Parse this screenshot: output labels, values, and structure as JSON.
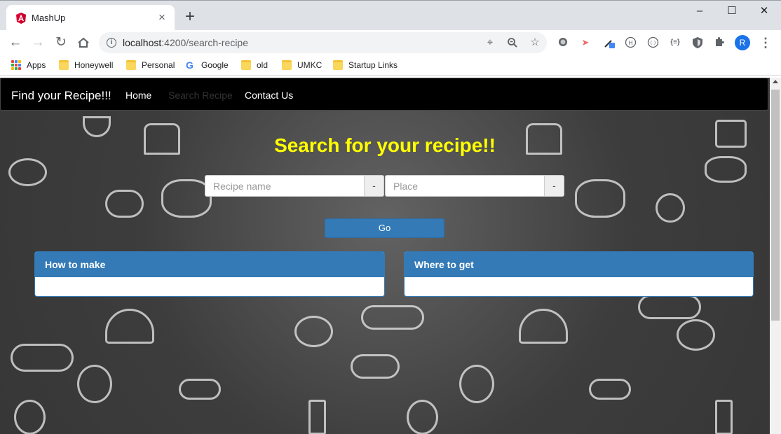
{
  "browser": {
    "tab_title": "MashUp",
    "tab_close": "×",
    "new_tab": "+",
    "url_host": "localhost",
    "url_rest": ":4200/search-recipe",
    "profile_initial": "R",
    "window_controls": {
      "minimize": "–",
      "maximize": "☐",
      "close": "✕"
    },
    "icons": [
      "back-icon",
      "forward-icon",
      "reload-icon",
      "home-icon",
      "info-icon",
      "location-icon",
      "zoom-icon",
      "star-icon"
    ],
    "bookmarks": [
      "Apps",
      "Honeywell",
      "Personal",
      "Google",
      "old",
      "UMKC",
      "Startup Links"
    ]
  },
  "app": {
    "brand": "Find your Recipe!!!",
    "nav": [
      "Home",
      "Search Recipe",
      "Contact Us"
    ],
    "active_nav": "Search Recipe",
    "headline": "Search for your recipe!!",
    "search": {
      "recipe_placeholder": "Recipe name",
      "place_placeholder": "Place",
      "addon": "-",
      "go_label": "Go"
    },
    "panels": {
      "how_to_make": "How to make",
      "where_to_get": "Where to get"
    },
    "colors": {
      "primary": "#337ab7",
      "headline": "#ffff00",
      "navbar": "#000000"
    }
  }
}
